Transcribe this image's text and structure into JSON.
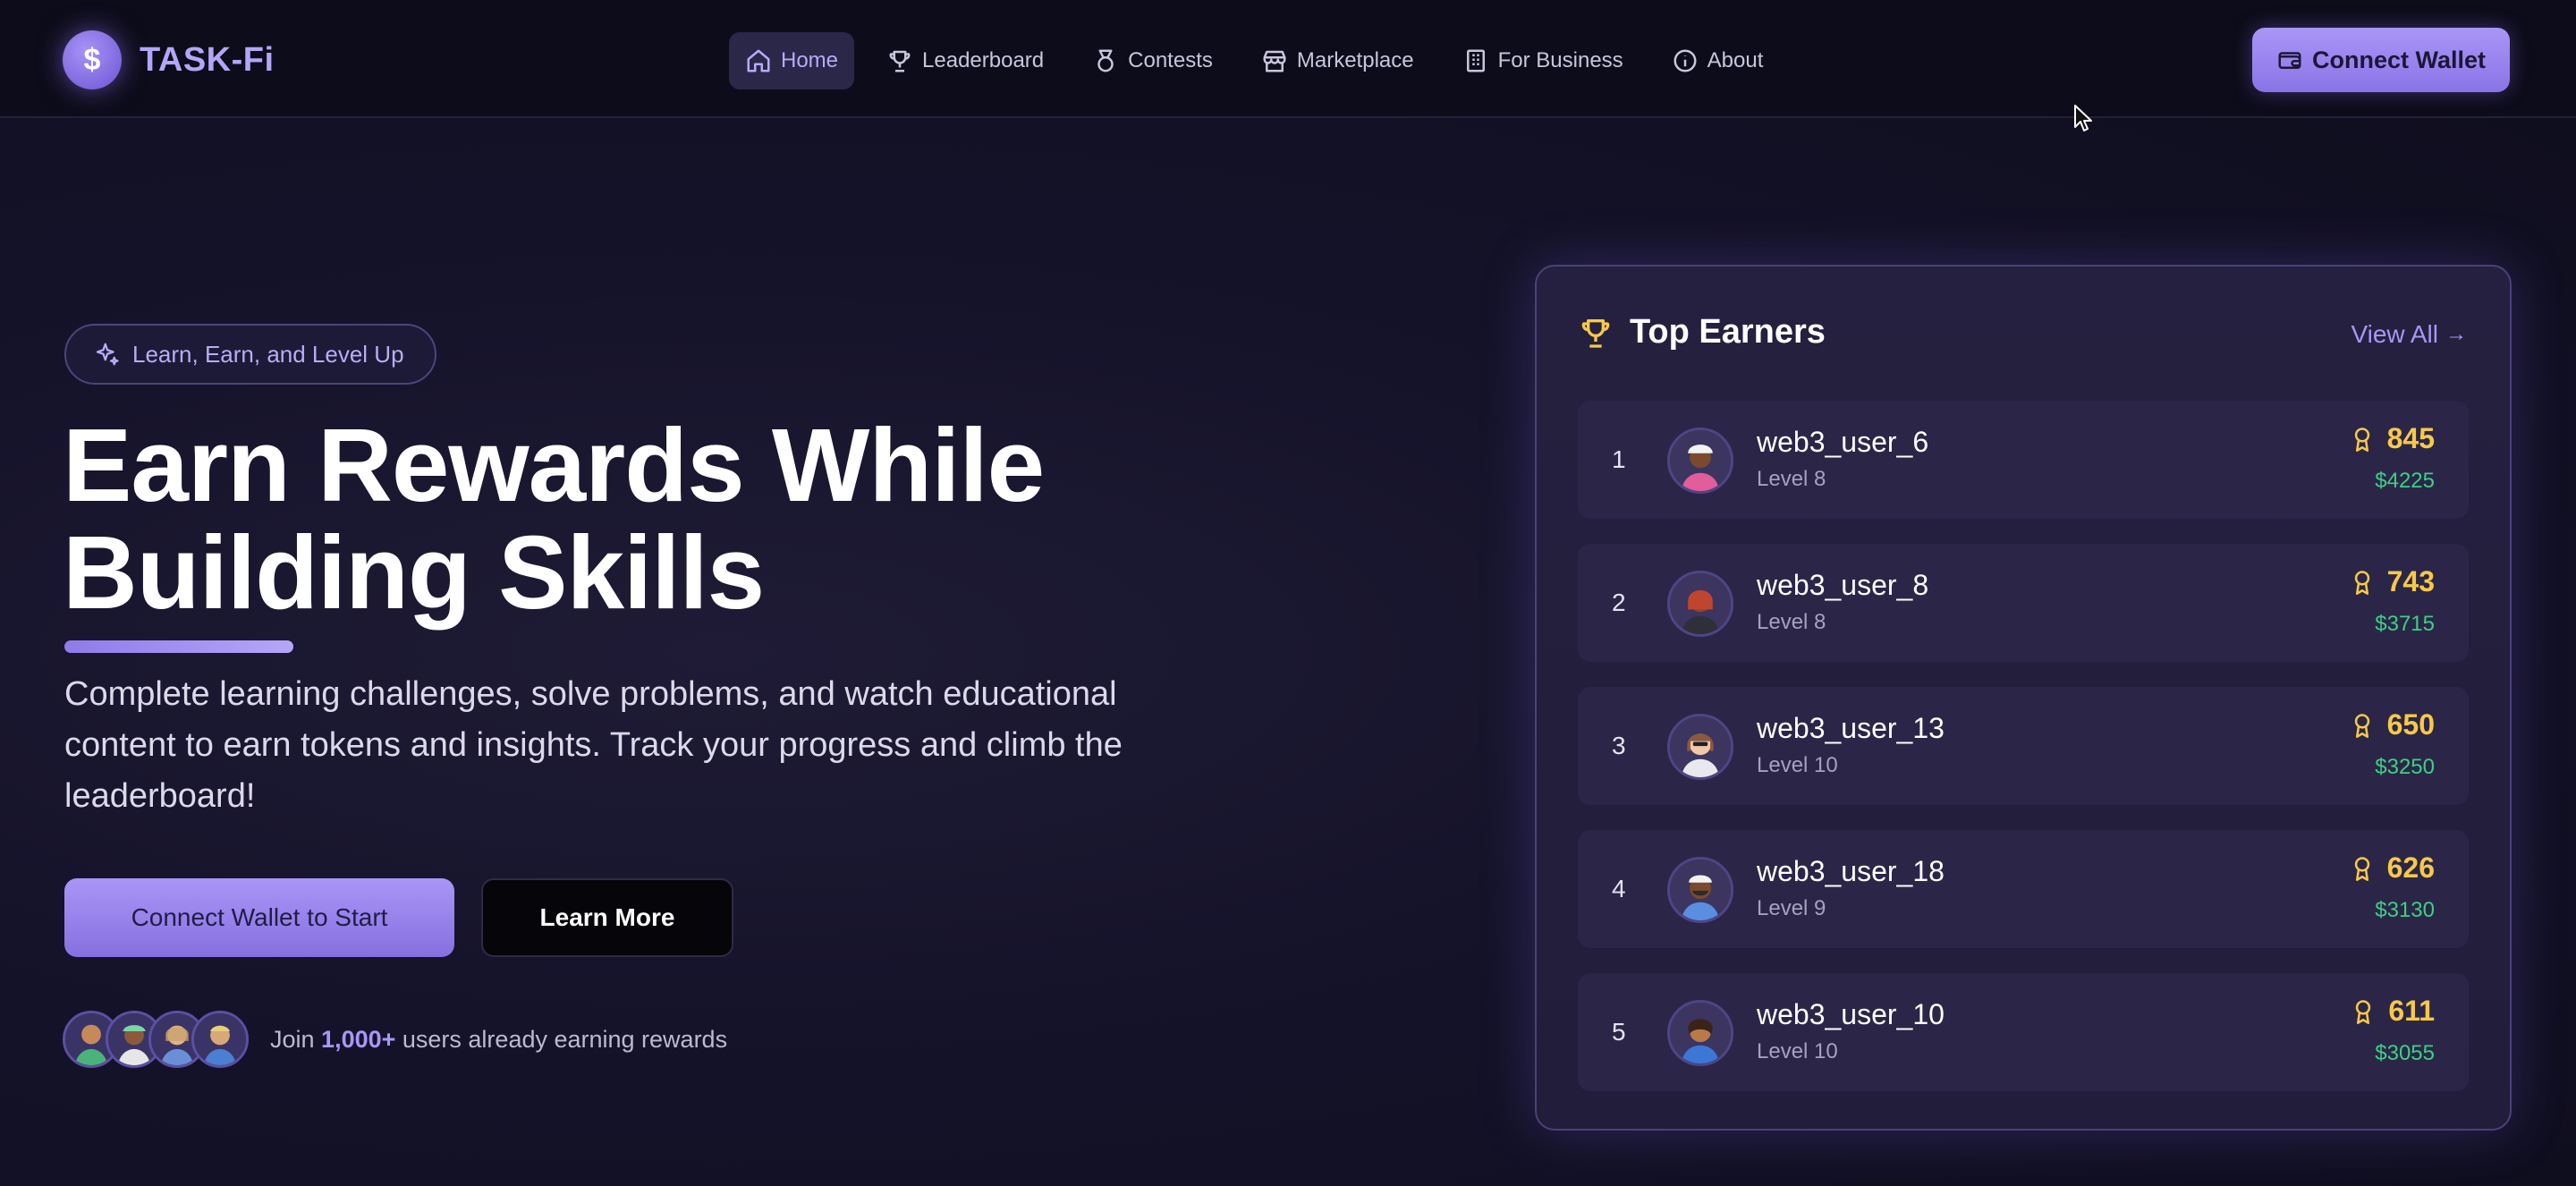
{
  "brand": {
    "name": "TASK-Fi",
    "symbol": "$"
  },
  "nav": {
    "items": [
      {
        "label": "Home",
        "icon": "home-icon",
        "active": true
      },
      {
        "label": "Leaderboard",
        "icon": "trophy-icon",
        "active": false
      },
      {
        "label": "Contests",
        "icon": "medal-icon",
        "active": false
      },
      {
        "label": "Marketplace",
        "icon": "store-icon",
        "active": false
      },
      {
        "label": "For Business",
        "icon": "building-icon",
        "active": false
      },
      {
        "label": "About",
        "icon": "info-icon",
        "active": false
      }
    ],
    "connect_wallet": "Connect Wallet"
  },
  "hero": {
    "badge": "Learn, Earn, and Level Up",
    "title_line1": "Earn Rewards While",
    "title_line2": "Building Skills",
    "description": "Complete learning challenges, solve problems, and watch educational content to earn tokens and insights. Track your progress and climb the leaderboard!",
    "primary_button": "Connect Wallet to Start",
    "secondary_button": "Learn More",
    "social_prefix": "Join ",
    "social_count": "1,000+",
    "social_suffix": " users already earning rewards"
  },
  "leaderboard": {
    "title": "Top Earners",
    "view_all": "View All",
    "entries": [
      {
        "rank": "1",
        "username": "web3_user_6",
        "level": "Level 8",
        "points": "845",
        "usd": "$4225"
      },
      {
        "rank": "2",
        "username": "web3_user_8",
        "level": "Level 8",
        "points": "743",
        "usd": "$3715"
      },
      {
        "rank": "3",
        "username": "web3_user_13",
        "level": "Level 10",
        "points": "650",
        "usd": "$3250"
      },
      {
        "rank": "4",
        "username": "web3_user_18",
        "level": "Level 9",
        "points": "626",
        "usd": "$3130"
      },
      {
        "rank": "5",
        "username": "web3_user_10",
        "level": "Level 10",
        "points": "611",
        "usd": "$3055"
      }
    ]
  },
  "colors": {
    "accent": "#a996f6",
    "background": "#15132a",
    "gold": "#f7c948",
    "green": "#3ecf84"
  }
}
